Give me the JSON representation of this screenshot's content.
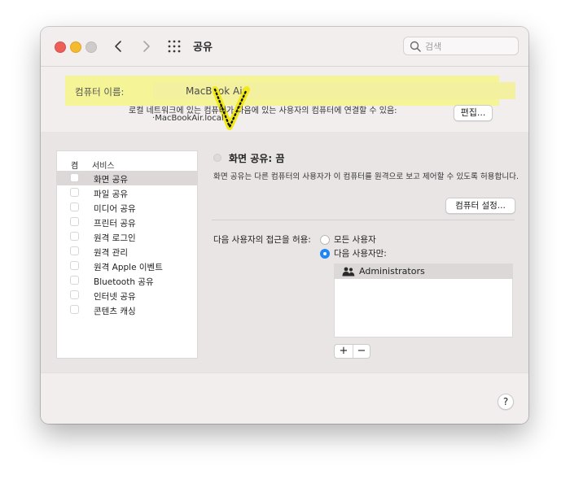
{
  "window": {
    "title": "공유",
    "search_placeholder": "검색"
  },
  "computer_name": {
    "label": "컴퓨터 이름:",
    "value": "MacBook Air",
    "description": "로컬 네트워크에 있는 컴퓨터가 다음에 있는 사용자의 컴퓨터에 연결할 수 있음:",
    "address": "MacBookAir.local",
    "edit_label": "편집..."
  },
  "services": {
    "header_on": "켬",
    "header_service": "서비스",
    "items": [
      {
        "label": "화면 공유",
        "checked": false,
        "selected": true
      },
      {
        "label": "파일 공유",
        "checked": false
      },
      {
        "label": "미디어 공유",
        "checked": false
      },
      {
        "label": "프린터 공유",
        "checked": false
      },
      {
        "label": "원격 로그인",
        "checked": false
      },
      {
        "label": "원격 관리",
        "checked": false
      },
      {
        "label": "원격 Apple 이벤트",
        "checked": false
      },
      {
        "label": "Bluetooth 공유",
        "checked": false
      },
      {
        "label": "인터넷 공유",
        "checked": false
      },
      {
        "label": "콘텐츠 캐싱",
        "checked": false
      }
    ]
  },
  "detail": {
    "status_title": "화면 공유: 끔",
    "status_description": "화면 공유는 다른 컴퓨터의 사용자가 이 컴퓨터를 원격으로 보고 제어할 수 있도록 허용합니다.",
    "computer_settings_label": "컴퓨터 설정...",
    "access_label": "다음 사용자의 접근을 허용:",
    "option_all": "모든 사용자",
    "option_only": "다음 사용자만:",
    "selected_option": "only",
    "users": [
      "Administrators"
    ],
    "add_label": "+",
    "remove_label": "−"
  },
  "help_label": "?",
  "colors": {
    "highlight": "#f5f497",
    "annotation_check": "#f2ea18",
    "accent": "#1f86f8"
  }
}
